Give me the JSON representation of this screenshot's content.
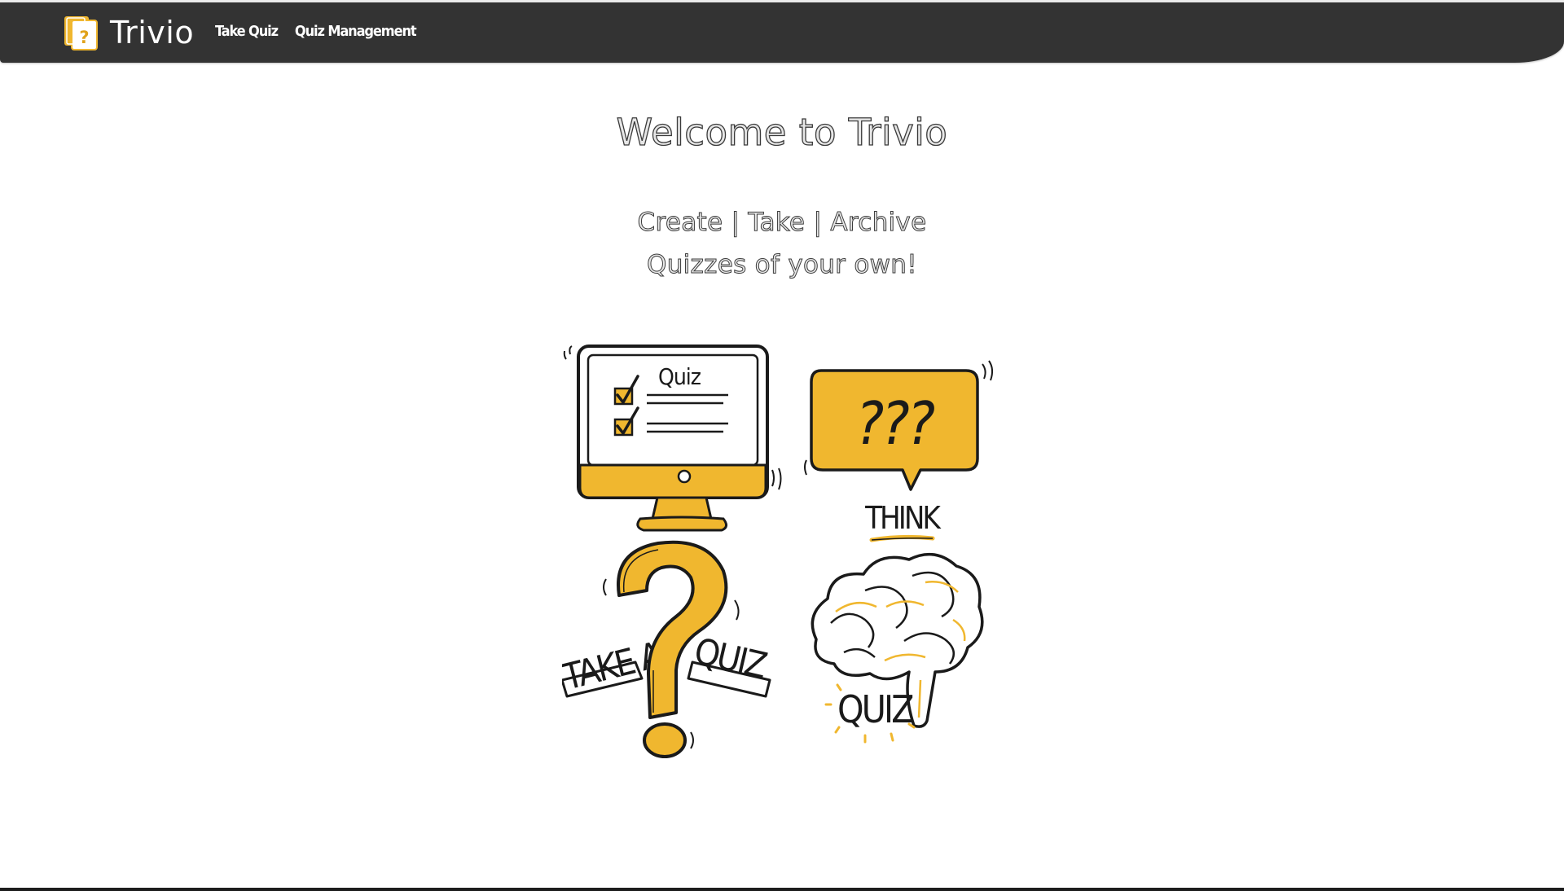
{
  "app": {
    "name": "Trivio"
  },
  "nav": {
    "links": [
      {
        "label": "Take Quiz"
      },
      {
        "label": "Quiz Management"
      }
    ]
  },
  "hero": {
    "title": "Welcome to Trivio",
    "tagline_line1": "Create | Take | Archive",
    "tagline_line2": "Quizzes of your own!"
  },
  "illustration": {
    "monitor_label": "Quiz",
    "bubble_text": "???",
    "think_label": "THINK",
    "take_a_label": "TAKE A",
    "quiz_banner_label": "QUIZ",
    "brain_label": "QUIZ"
  },
  "colors": {
    "navbar_bg": "#333333",
    "accent_yellow": "#F0B72F",
    "ink": "#1a1a1a"
  },
  "icons": [
    "logo-question-card-icon"
  ]
}
